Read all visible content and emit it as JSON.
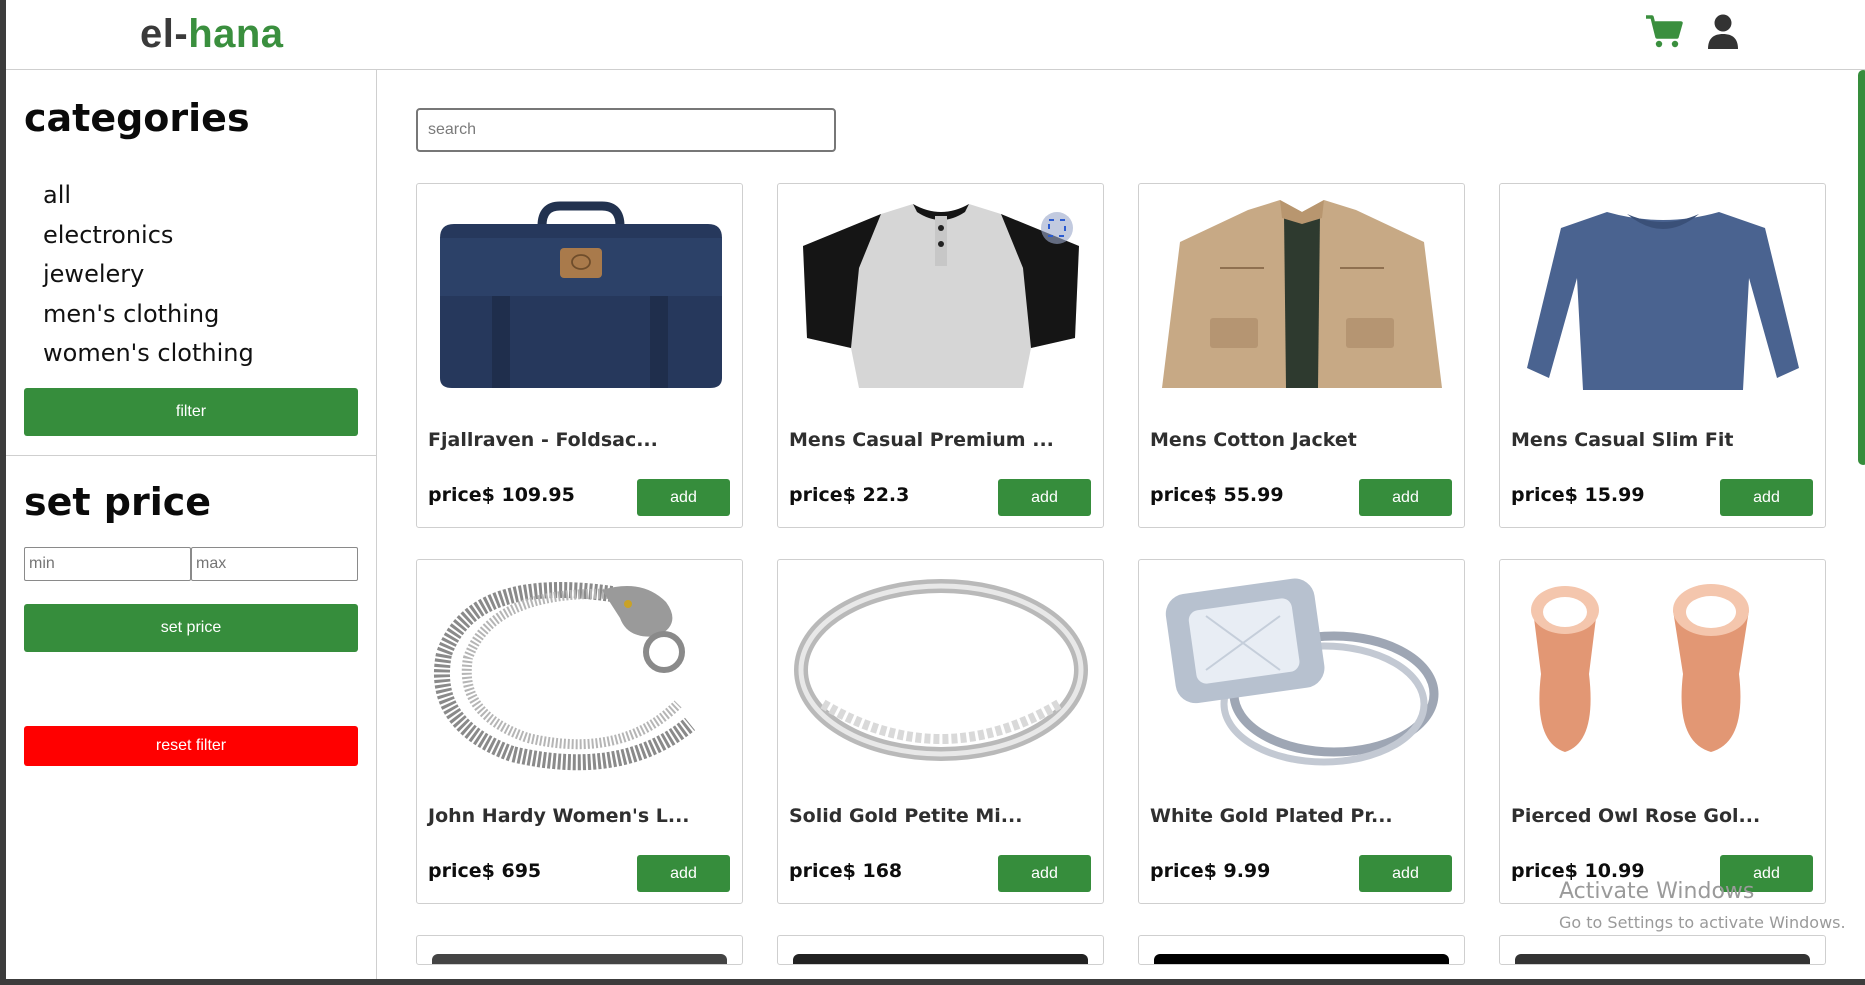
{
  "header": {
    "logo_part1": "el-",
    "logo_part2": "hana",
    "cart_icon": "cart-icon",
    "user_icon": "user-icon",
    "brand_color": "#3a8f3e"
  },
  "sidebar": {
    "categories_title": "categories",
    "categories": [
      "all",
      "electronics",
      "jewelery",
      "men's clothing",
      "women's clothing"
    ],
    "filter_label": "filter",
    "price_title": "set price",
    "min_placeholder": "min",
    "max_placeholder": "max",
    "set_price_label": "set price",
    "reset_label": "reset filter",
    "reset_color": "#ff0000"
  },
  "search": {
    "placeholder": "search"
  },
  "products": [
    {
      "title": "Fjallraven - Foldsac...",
      "price": "price$ 109.95",
      "add_label": "add",
      "image": "backpack"
    },
    {
      "title": "Mens Casual Premium ...",
      "price": "price$ 22.3",
      "add_label": "add",
      "image": "raglan-tshirt"
    },
    {
      "title": "Mens Cotton Jacket",
      "price": "price$ 55.99",
      "add_label": "add",
      "image": "cotton-jacket"
    },
    {
      "title": "Mens Casual Slim Fit",
      "price": "price$ 15.99",
      "add_label": "add",
      "image": "long-sleeve-shirt"
    },
    {
      "title": "John Hardy Women's L...",
      "price": "price$ 695",
      "add_label": "add",
      "image": "dragon-bracelet"
    },
    {
      "title": "Solid Gold Petite Mi...",
      "price": "price$ 168",
      "add_label": "add",
      "image": "micropave-ring"
    },
    {
      "title": "White Gold Plated Pr...",
      "price": "price$ 9.99",
      "add_label": "add",
      "image": "princess-ring"
    },
    {
      "title": "Pierced Owl Rose Gol...",
      "price": "price$ 10.99",
      "add_label": "add",
      "image": "rose-gold-plugs"
    }
  ],
  "watermark": {
    "line1": "Activate Windows",
    "line2": "Go to Settings to activate Windows."
  }
}
